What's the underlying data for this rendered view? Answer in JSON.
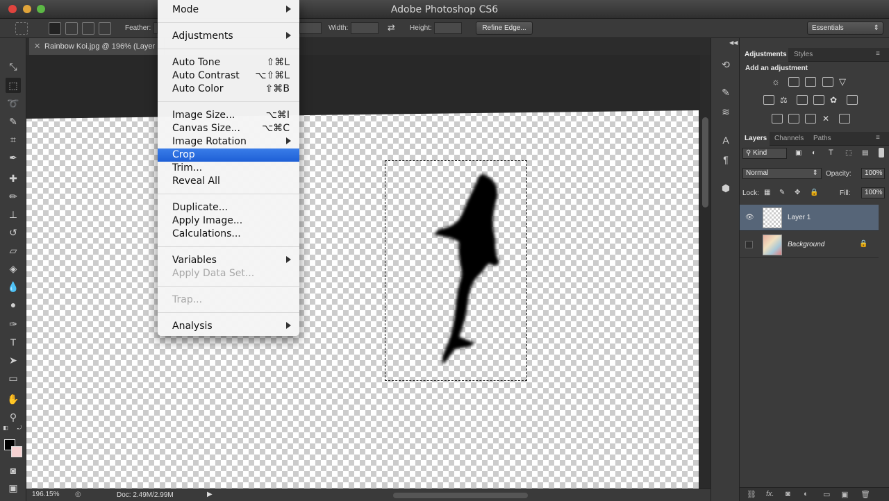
{
  "titlebar": {
    "app_title": "Adobe Photoshop CS6"
  },
  "options_bar": {
    "feather_label": "Feather:",
    "width_label": "Width:",
    "height_label": "Height:",
    "refine_edge_label": "Refine Edge...",
    "workspace_value": "Essentials"
  },
  "document": {
    "tab_title": "Rainbow Koi.jpg @ 196% (Layer",
    "zoom": "196.15%",
    "doc_size": "Doc: 2.49M/2.99M"
  },
  "image_menu": {
    "items": [
      {
        "label": "Mode",
        "shortcut": "",
        "submenu": true,
        "disabled": false,
        "highlight": false
      },
      {
        "label": "Adjustments",
        "shortcut": "",
        "submenu": true,
        "disabled": false,
        "highlight": false
      },
      {
        "label": "Auto Tone",
        "shortcut": "⇧⌘L",
        "submenu": false,
        "disabled": false,
        "highlight": false
      },
      {
        "label": "Auto Contrast",
        "shortcut": "⌥⇧⌘L",
        "submenu": false,
        "disabled": false,
        "highlight": false
      },
      {
        "label": "Auto Color",
        "shortcut": "⇧⌘B",
        "submenu": false,
        "disabled": false,
        "highlight": false
      },
      {
        "label": "Image Size...",
        "shortcut": "⌥⌘I",
        "submenu": false,
        "disabled": false,
        "highlight": false
      },
      {
        "label": "Canvas Size...",
        "shortcut": "⌥⌘C",
        "submenu": false,
        "disabled": false,
        "highlight": false
      },
      {
        "label": "Image Rotation",
        "shortcut": "",
        "submenu": true,
        "disabled": false,
        "highlight": false
      },
      {
        "label": "Crop",
        "shortcut": "",
        "submenu": false,
        "disabled": false,
        "highlight": true
      },
      {
        "label": "Trim...",
        "shortcut": "",
        "submenu": false,
        "disabled": false,
        "highlight": false
      },
      {
        "label": "Reveal All",
        "shortcut": "",
        "submenu": false,
        "disabled": false,
        "highlight": false
      },
      {
        "label": "Duplicate...",
        "shortcut": "",
        "submenu": false,
        "disabled": false,
        "highlight": false
      },
      {
        "label": "Apply Image...",
        "shortcut": "",
        "submenu": false,
        "disabled": false,
        "highlight": false
      },
      {
        "label": "Calculations...",
        "shortcut": "",
        "submenu": false,
        "disabled": false,
        "highlight": false
      },
      {
        "label": "Variables",
        "shortcut": "",
        "submenu": true,
        "disabled": false,
        "highlight": false
      },
      {
        "label": "Apply Data Set...",
        "shortcut": "",
        "submenu": false,
        "disabled": true,
        "highlight": false
      },
      {
        "label": "Trap...",
        "shortcut": "",
        "submenu": false,
        "disabled": true,
        "highlight": false
      },
      {
        "label": "Analysis",
        "shortcut": "",
        "submenu": true,
        "disabled": false,
        "highlight": false
      }
    ]
  },
  "adjustments_panel": {
    "tabs": [
      "Adjustments",
      "Styles"
    ],
    "heading": "Add an adjustment"
  },
  "layers_panel": {
    "tabs": [
      "Layers",
      "Channels",
      "Paths"
    ],
    "filter_value": "Kind",
    "blend_mode": "Normal",
    "opacity_label": "Opacity:",
    "opacity_value": "100%",
    "lock_label": "Lock:",
    "fill_label": "Fill:",
    "fill_value": "100%",
    "layers": [
      {
        "name": "Layer 1",
        "visible": true,
        "selected": true,
        "locked": false
      },
      {
        "name": "Background",
        "visible": false,
        "selected": false,
        "locked": true
      }
    ]
  },
  "colors": {
    "menu_highlight": "#1e5fd6",
    "selected_layer": "#566578",
    "foreground": "#000000",
    "background": "#f6d2d2"
  }
}
